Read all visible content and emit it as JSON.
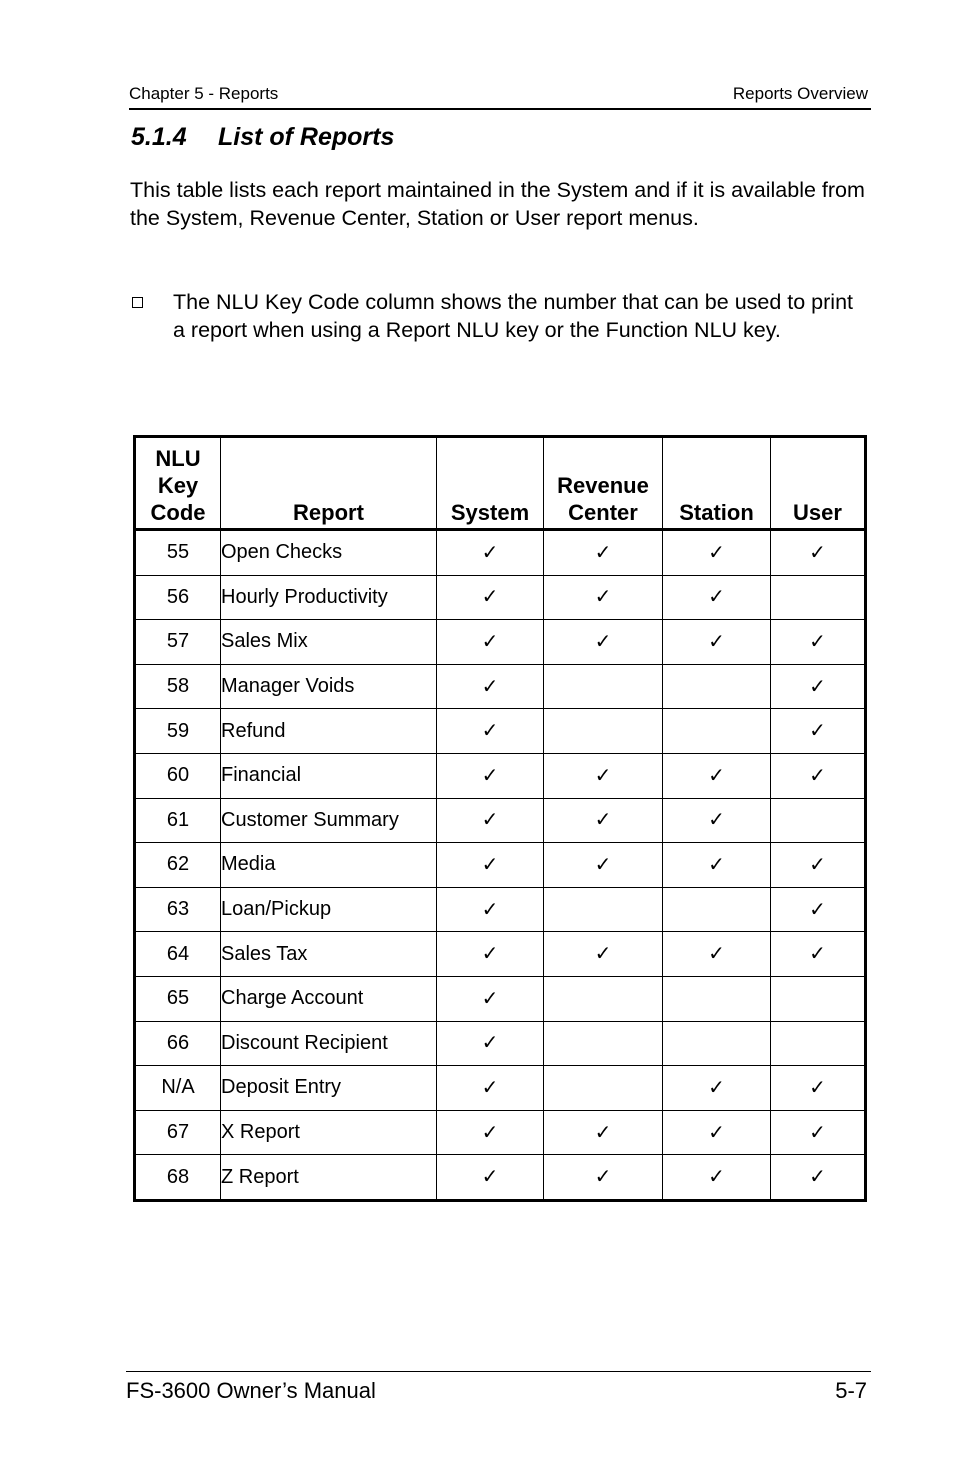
{
  "header": {
    "chapter": "Chapter 5 - Reports",
    "section": "Reports Overview"
  },
  "title": {
    "number": "5.1.4",
    "text": "List of Reports"
  },
  "intro": "This table lists each report maintained in the System and if it is available from the System, Revenue Center, Station or User report menus.",
  "bullet": "The NLU Key Code column shows the number that can be used to print a report when using a Report NLU key or the Function NLU key.",
  "check_glyph": "✓",
  "table": {
    "columns": [
      "NLU Key Code",
      "Report",
      "System",
      "Revenue Center",
      "Station",
      "User"
    ],
    "rows": [
      {
        "code": "55",
        "report": "Open Checks",
        "system": true,
        "revenue_center": true,
        "station": true,
        "user": true
      },
      {
        "code": "56",
        "report": "Hourly Productivity",
        "system": true,
        "revenue_center": true,
        "station": true,
        "user": false
      },
      {
        "code": "57",
        "report": "Sales Mix",
        "system": true,
        "revenue_center": true,
        "station": true,
        "user": true
      },
      {
        "code": "58",
        "report": "Manager Voids",
        "system": true,
        "revenue_center": false,
        "station": false,
        "user": true
      },
      {
        "code": "59",
        "report": "Refund",
        "system": true,
        "revenue_center": false,
        "station": false,
        "user": true
      },
      {
        "code": "60",
        "report": "Financial",
        "system": true,
        "revenue_center": true,
        "station": true,
        "user": true
      },
      {
        "code": "61",
        "report": "Customer Summary",
        "system": true,
        "revenue_center": true,
        "station": true,
        "user": false
      },
      {
        "code": "62",
        "report": "Media",
        "system": true,
        "revenue_center": true,
        "station": true,
        "user": true
      },
      {
        "code": "63",
        "report": "Loan/Pickup",
        "system": true,
        "revenue_center": false,
        "station": false,
        "user": true
      },
      {
        "code": "64",
        "report": "Sales Tax",
        "system": true,
        "revenue_center": true,
        "station": true,
        "user": true
      },
      {
        "code": "65",
        "report": "Charge Account",
        "system": true,
        "revenue_center": false,
        "station": false,
        "user": false
      },
      {
        "code": "66",
        "report": "Discount Recipient",
        "system": true,
        "revenue_center": false,
        "station": false,
        "user": false
      },
      {
        "code": "N/A",
        "report": "Deposit Entry",
        "system": true,
        "revenue_center": false,
        "station": true,
        "user": true
      },
      {
        "code": "67",
        "report": "X Report",
        "system": true,
        "revenue_center": true,
        "station": true,
        "user": true
      },
      {
        "code": "68",
        "report": "Z Report",
        "system": true,
        "revenue_center": true,
        "station": true,
        "user": true
      }
    ]
  },
  "footer": {
    "manual": "FS-3600 Owner’s Manual",
    "page": "5-7"
  }
}
